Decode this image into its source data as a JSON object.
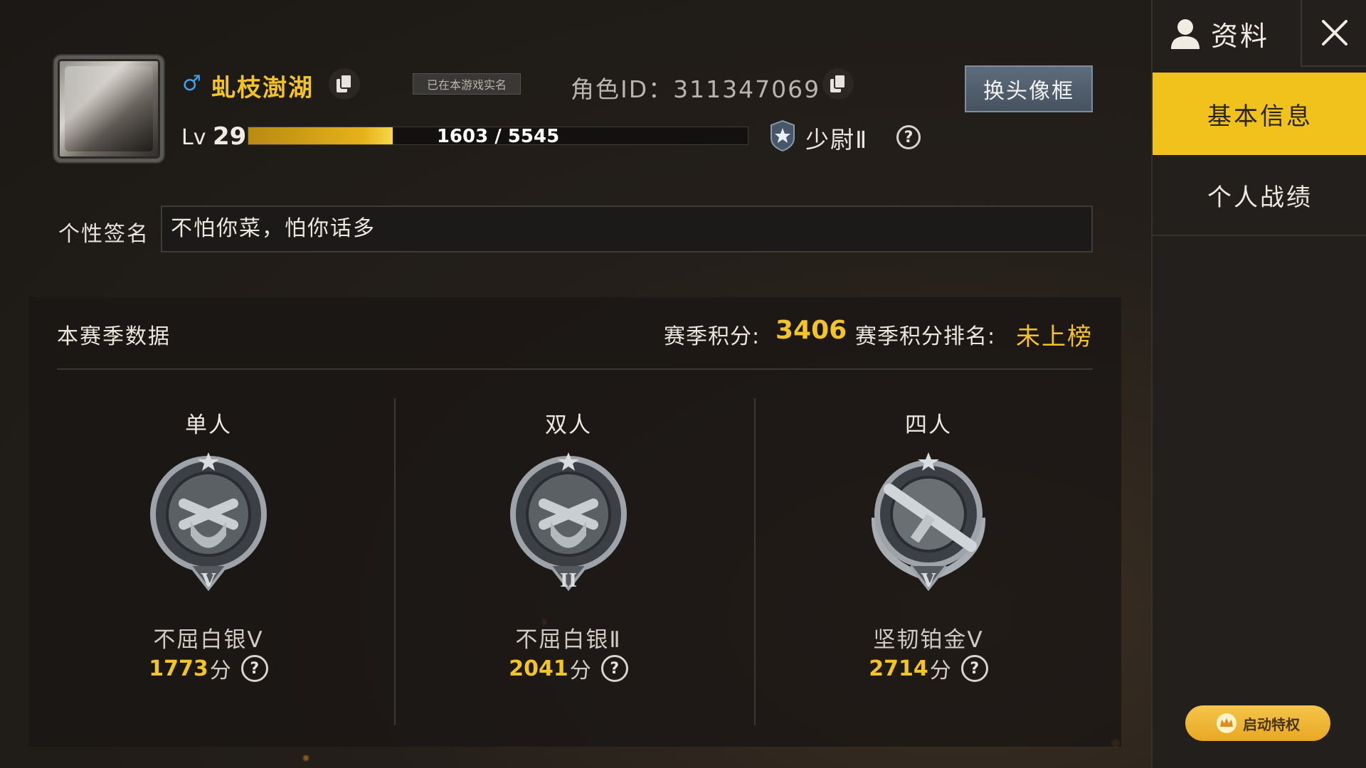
{
  "profile": {
    "gender_symbol": "♂",
    "name": "虬枝澍湖",
    "verified_badge": "已在本游戏实名",
    "role_id_label": "角色ID：",
    "role_id": "311347069",
    "change_frame_label": "换头像框",
    "level_prefix": "Lv",
    "level": "29",
    "xp_text": "1603 / 5545",
    "xp_progress": 0.289,
    "rank_title": "少尉Ⅱ",
    "signature_label": "个性签名",
    "signature": "不怕你菜，怕你话多"
  },
  "season": {
    "title": "本赛季数据",
    "score_label": "赛季积分:",
    "score_value": "3406",
    "rank_label": "赛季积分排名:",
    "rank_value": "未上榜",
    "modes": [
      {
        "name": "单人",
        "tier": "不屈白银Ⅴ",
        "score": "1773",
        "unit": "分",
        "badge_numeral": "V"
      },
      {
        "name": "双人",
        "tier": "不屈白银Ⅱ",
        "score": "2041",
        "unit": "分",
        "badge_numeral": "II"
      },
      {
        "name": "四人",
        "tier": "坚韧铂金Ⅴ",
        "score": "2714",
        "unit": "分",
        "badge_numeral": "V"
      }
    ]
  },
  "sidebar": {
    "title": "资料",
    "tabs": [
      {
        "label": "基本信息",
        "active": true
      },
      {
        "label": "个人战绩",
        "active": false
      }
    ],
    "privilege_label": "启动特权"
  },
  "icons": {
    "help": "?",
    "accent_color": "#f3c32a"
  }
}
